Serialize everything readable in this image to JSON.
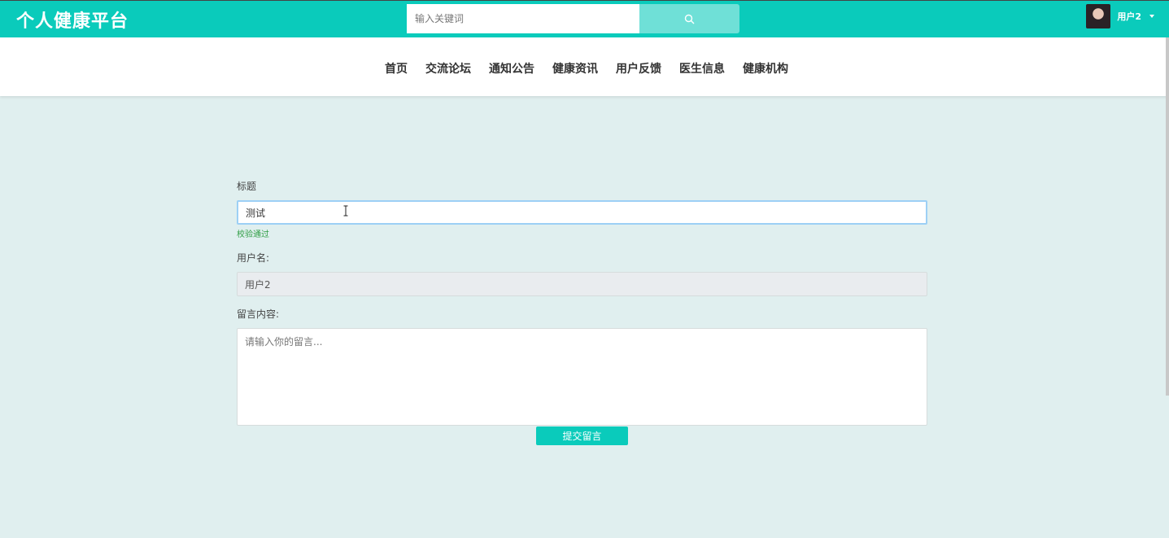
{
  "header": {
    "logo": "个人健康平台",
    "search": {
      "placeholder": "输入关键词",
      "button_icon": "search-icon"
    },
    "user": {
      "name": "用户2",
      "avatar_icon": "avatar-photo",
      "caret_icon": "caret-down-icon"
    }
  },
  "nav": {
    "items": [
      {
        "label": "首页"
      },
      {
        "label": "交流论坛"
      },
      {
        "label": "通知公告"
      },
      {
        "label": "健康资讯"
      },
      {
        "label": "用户反馈"
      },
      {
        "label": "医生信息"
      },
      {
        "label": "健康机构"
      }
    ]
  },
  "form": {
    "title_label": "标题",
    "title_value": "测试",
    "title_hint": "校验通过",
    "username_label": "用户名:",
    "username_value": "用户2",
    "content_label": "留言内容:",
    "content_placeholder": "请输入你的留言...",
    "submit_label": "提交留言"
  },
  "colors": {
    "brand": "#0acbbb",
    "page_bg": "#e0efef",
    "success": "#2e9d43"
  }
}
